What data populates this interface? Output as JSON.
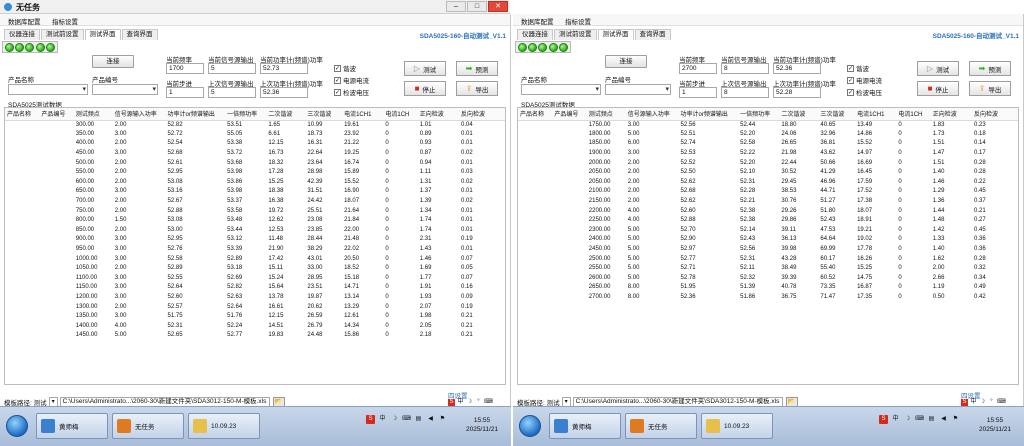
{
  "app_title": "无任务",
  "menu": [
    "数据库配置",
    "指标设置"
  ],
  "tabs": [
    "仪器连接",
    "测试前设置",
    "测试界面",
    "查询界面"
  ],
  "version": "SDA5025-160-自动测试_V1.1",
  "buttons": {
    "connect": "连接",
    "test": "测试",
    "predict": "预测",
    "stop": "停止",
    "export": "导出",
    "browse": "..."
  },
  "labels": {
    "product_name": "产品名称",
    "product_code": "产品编号",
    "current_freq": "当前频率",
    "current_signal": "当前信号源输出",
    "current_power": "当前功率计(频谱)功率",
    "current_step": "当前步进",
    "last_signal": "上次信号源输出",
    "last_power": "上次功率计(频谱)功率",
    "data_title": "SDA5025测试数据",
    "template_path": "模板路径: 测试",
    "port_settings": "四设置"
  },
  "checkboxes": [
    {
      "label": "谐波",
      "checked": true
    },
    {
      "label": "电源电流",
      "checked": true
    },
    {
      "label": "检波电压",
      "checked": true
    }
  ],
  "columns": [
    "产品名称",
    "产品编号",
    "测试频点",
    "信号源输入功率",
    "功率计or频谱输出",
    "一倍频功率",
    "二次谐波",
    "三次谐波",
    "电流1CH1",
    "电流1CH",
    "正向检波",
    "反向检波"
  ],
  "panes": [
    {
      "current_freq": "1700",
      "current_signal": "5",
      "current_power": "52.73",
      "current_step": "1",
      "last_signal": "5",
      "last_power": "52.36",
      "path": "C:\\Users\\Administrato...\\2060-30\\新建文件夹\\SDA3012-150-M-模板.xls",
      "rows": [
        [
          "",
          "",
          "300.00",
          "2.00",
          "",
          "52.82",
          "53.51",
          "1.65",
          "10.99",
          "19.61",
          "0",
          "1.01",
          "0.04"
        ],
        [
          "",
          "",
          "350.00",
          "3.00",
          "",
          "52.72",
          "55.05",
          "6.61",
          "18.73",
          "23.92",
          "0",
          "0.89",
          "0.01"
        ],
        [
          "",
          "",
          "400.00",
          "2.00",
          "",
          "52.54",
          "53.38",
          "12.15",
          "16.31",
          "21.22",
          "0",
          "0.93",
          "0.01"
        ],
        [
          "",
          "",
          "450.00",
          "3.00",
          "",
          "52.68",
          "53.72",
          "16.73",
          "22.64",
          "19.25",
          "0",
          "0.87",
          "0.02"
        ],
        [
          "",
          "",
          "500.00",
          "2.00",
          "",
          "52.61",
          "53.68",
          "18.32",
          "23.64",
          "16.74",
          "0",
          "0.94",
          "0.01"
        ],
        [
          "",
          "",
          "550.00",
          "2.00",
          "",
          "52.95",
          "53.98",
          "17.28",
          "28.98",
          "15.89",
          "0",
          "1.11",
          "0.03"
        ],
        [
          "",
          "",
          "600.00",
          "2.00",
          "",
          "53.08",
          "53.86",
          "15.25",
          "42.39",
          "15.52",
          "0",
          "1.31",
          "0.02"
        ],
        [
          "",
          "",
          "650.00",
          "3.00",
          "",
          "53.16",
          "53.98",
          "18.38",
          "31.51",
          "16.90",
          "0",
          "1.37",
          "0.01"
        ],
        [
          "",
          "",
          "700.00",
          "2.00",
          "",
          "52.67",
          "53.37",
          "16.38",
          "24.42",
          "18.07",
          "0",
          "1.39",
          "0.02"
        ],
        [
          "",
          "",
          "750.00",
          "2.00",
          "",
          "52.88",
          "53.58",
          "19.72",
          "25.51",
          "21.64",
          "0",
          "1.34",
          "0.01"
        ],
        [
          "",
          "",
          "800.00",
          "1.50",
          "",
          "53.08",
          "53.48",
          "12.62",
          "23.08",
          "21.84",
          "0",
          "1.74",
          "0.01"
        ],
        [
          "",
          "",
          "850.00",
          "2.00",
          "",
          "53.00",
          "53.44",
          "12.53",
          "23.85",
          "22.00",
          "0",
          "1.74",
          "0.01"
        ],
        [
          "",
          "",
          "900.00",
          "3.00",
          "",
          "52.95",
          "53.12",
          "11.48",
          "28.44",
          "21.48",
          "0",
          "2.31",
          "0.19"
        ],
        [
          "",
          "",
          "950.00",
          "3.00",
          "",
          "52.76",
          "53.39",
          "21.90",
          "38.29",
          "22.02",
          "0",
          "1.43",
          "0.01"
        ],
        [
          "",
          "",
          "1000.00",
          "3.00",
          "",
          "52.58",
          "52.89",
          "17.42",
          "43.01",
          "20.50",
          "0",
          "1.46",
          "0.07"
        ],
        [
          "",
          "",
          "1050.00",
          "2.00",
          "",
          "52.89",
          "53.18",
          "15.11",
          "33.00",
          "18.52",
          "0",
          "1.69",
          "0.05"
        ],
        [
          "",
          "",
          "1100.00",
          "3.00",
          "",
          "52.55",
          "52.69",
          "15.24",
          "28.95",
          "15.18",
          "0",
          "1.77",
          "0.07"
        ],
        [
          "",
          "",
          "1150.00",
          "3.00",
          "",
          "52.64",
          "52.82",
          "15.64",
          "23.51",
          "14.71",
          "0",
          "1.91",
          "0.16"
        ],
        [
          "",
          "",
          "1200.00",
          "3.00",
          "",
          "52.60",
          "52.63",
          "13.78",
          "19.87",
          "13.14",
          "0",
          "1.93",
          "0.09"
        ],
        [
          "",
          "",
          "1300.00",
          "2.00",
          "",
          "52.57",
          "52.64",
          "16.61",
          "20.62",
          "13.29",
          "0",
          "2.07",
          "0.19"
        ],
        [
          "",
          "",
          "1350.00",
          "3.00",
          "",
          "51.75",
          "51.76",
          "12.15",
          "26.59",
          "12.61",
          "0",
          "1.98",
          "0.21"
        ],
        [
          "",
          "",
          "1400.00",
          "4.00",
          "",
          "52.31",
          "52.24",
          "14.51",
          "26.79",
          "14.34",
          "0",
          "2.05",
          "0.21"
        ],
        [
          "",
          "",
          "1450.00",
          "5.00",
          "",
          "52.65",
          "52.77",
          "19.83",
          "24.48",
          "15.86",
          "0",
          "2.18",
          "0.21"
        ]
      ]
    },
    {
      "current_freq": "2700",
      "current_signal": "8",
      "current_power": "52.36",
      "current_step": "1",
      "last_signal": "8",
      "last_power": "52.28",
      "path": "C:\\Users\\Administrato...\\2060-30\\新建文件夹\\SDA3012-150-M-模板.xls",
      "rows": [
        [
          "",
          "",
          "1750.00",
          "3.00",
          "",
          "52.56",
          "52.44",
          "18.80",
          "40.65",
          "13.49",
          "0",
          "1.83",
          "0.23"
        ],
        [
          "",
          "",
          "1800.00",
          "5.00",
          "",
          "52.51",
          "52.20",
          "24.06",
          "32.96",
          "14.86",
          "0",
          "1.73",
          "0.18"
        ],
        [
          "",
          "",
          "1850.00",
          "6.00",
          "",
          "52.74",
          "52.58",
          "26.65",
          "36.81",
          "15.52",
          "0",
          "1.51",
          "0.14"
        ],
        [
          "",
          "",
          "1900.00",
          "3.00",
          "",
          "52.53",
          "52.22",
          "21.98",
          "43.62",
          "14.97",
          "0",
          "1.47",
          "0.17"
        ],
        [
          "",
          "",
          "2000.00",
          "2.00",
          "",
          "52.52",
          "52.20",
          "22.44",
          "50.66",
          "16.69",
          "0",
          "1.51",
          "0.28"
        ],
        [
          "",
          "",
          "2050.00",
          "2.00",
          "",
          "52.50",
          "52.10",
          "30.52",
          "41.29",
          "16.45",
          "0",
          "1.40",
          "0.28"
        ],
        [
          "",
          "",
          "2050.00",
          "2.00",
          "",
          "52.62",
          "52.31",
          "29.45",
          "46.96",
          "17.59",
          "0",
          "1.46",
          "0.22"
        ],
        [
          "",
          "",
          "2100.00",
          "2.00",
          "",
          "52.68",
          "52.28",
          "38.53",
          "44.71",
          "17.52",
          "0",
          "1.29",
          "0.45"
        ],
        [
          "",
          "",
          "2150.00",
          "2.00",
          "",
          "52.62",
          "52.21",
          "30.76",
          "51.27",
          "17.38",
          "0",
          "1.36",
          "0.37"
        ],
        [
          "",
          "",
          "2200.00",
          "4.00",
          "",
          "52.60",
          "52.38",
          "29.26",
          "51.80",
          "18.07",
          "0",
          "1.44",
          "0.21"
        ],
        [
          "",
          "",
          "2250.00",
          "4.00",
          "",
          "52.88",
          "52.38",
          "29.86",
          "52.43",
          "18.91",
          "0",
          "1.48",
          "0.27"
        ],
        [
          "",
          "",
          "2300.00",
          "5.00",
          "",
          "52.70",
          "52.14",
          "39.11",
          "47.53",
          "19.21",
          "0",
          "1.42",
          "0.45"
        ],
        [
          "",
          "",
          "2400.00",
          "5.00",
          "",
          "52.90",
          "52.43",
          "36.13",
          "64.64",
          "19.02",
          "0",
          "1.33",
          "0.36"
        ],
        [
          "",
          "",
          "2450.00",
          "5.00",
          "",
          "52.97",
          "52.56",
          "39.98",
          "69.99",
          "17.78",
          "0",
          "1.40",
          "0.36"
        ],
        [
          "",
          "",
          "2500.00",
          "5.00",
          "",
          "52.77",
          "52.31",
          "43.28",
          "60.17",
          "16.26",
          "0",
          "1.62",
          "0.28"
        ],
        [
          "",
          "",
          "2550.00",
          "5.00",
          "",
          "52.71",
          "52.11",
          "38.49",
          "55.40",
          "15.25",
          "0",
          "2.00",
          "0.32"
        ],
        [
          "",
          "",
          "2600.00",
          "5.00",
          "",
          "52.78",
          "52.32",
          "39.39",
          "60.52",
          "14.75",
          "0",
          "2.66",
          "0.34"
        ],
        [
          "",
          "",
          "2650.00",
          "8.00",
          "",
          "51.95",
          "51.39",
          "40.78",
          "73.35",
          "16.87",
          "0",
          "1.19",
          "0.49"
        ],
        [
          "",
          "",
          "2700.00",
          "8.00",
          "",
          "52.36",
          "51.86",
          "36.75",
          "71.47",
          "17.35",
          "0",
          "0.50",
          "0.42"
        ]
      ]
    }
  ],
  "taskbar": [
    {
      "items": [
        "黄师梅",
        "无任务",
        "10.09.23"
      ],
      "time": "15:55",
      "date": "2025/11/21"
    },
    {
      "items": [
        "黄师梅",
        "无任务",
        "10.09.23"
      ],
      "time": "15:55",
      "date": "2025/11/21"
    }
  ],
  "colors": {
    "accent_blue": "#2a6fbd",
    "led_green": "#2fae20",
    "stop_red": "#d42a1e",
    "taskbar": "#b9cbe2"
  },
  "icons": [
    "app-icon",
    "led-indicator",
    "test-icon",
    "predict-icon",
    "stop-icon",
    "export-icon",
    "folder-icon",
    "start-orb"
  ]
}
